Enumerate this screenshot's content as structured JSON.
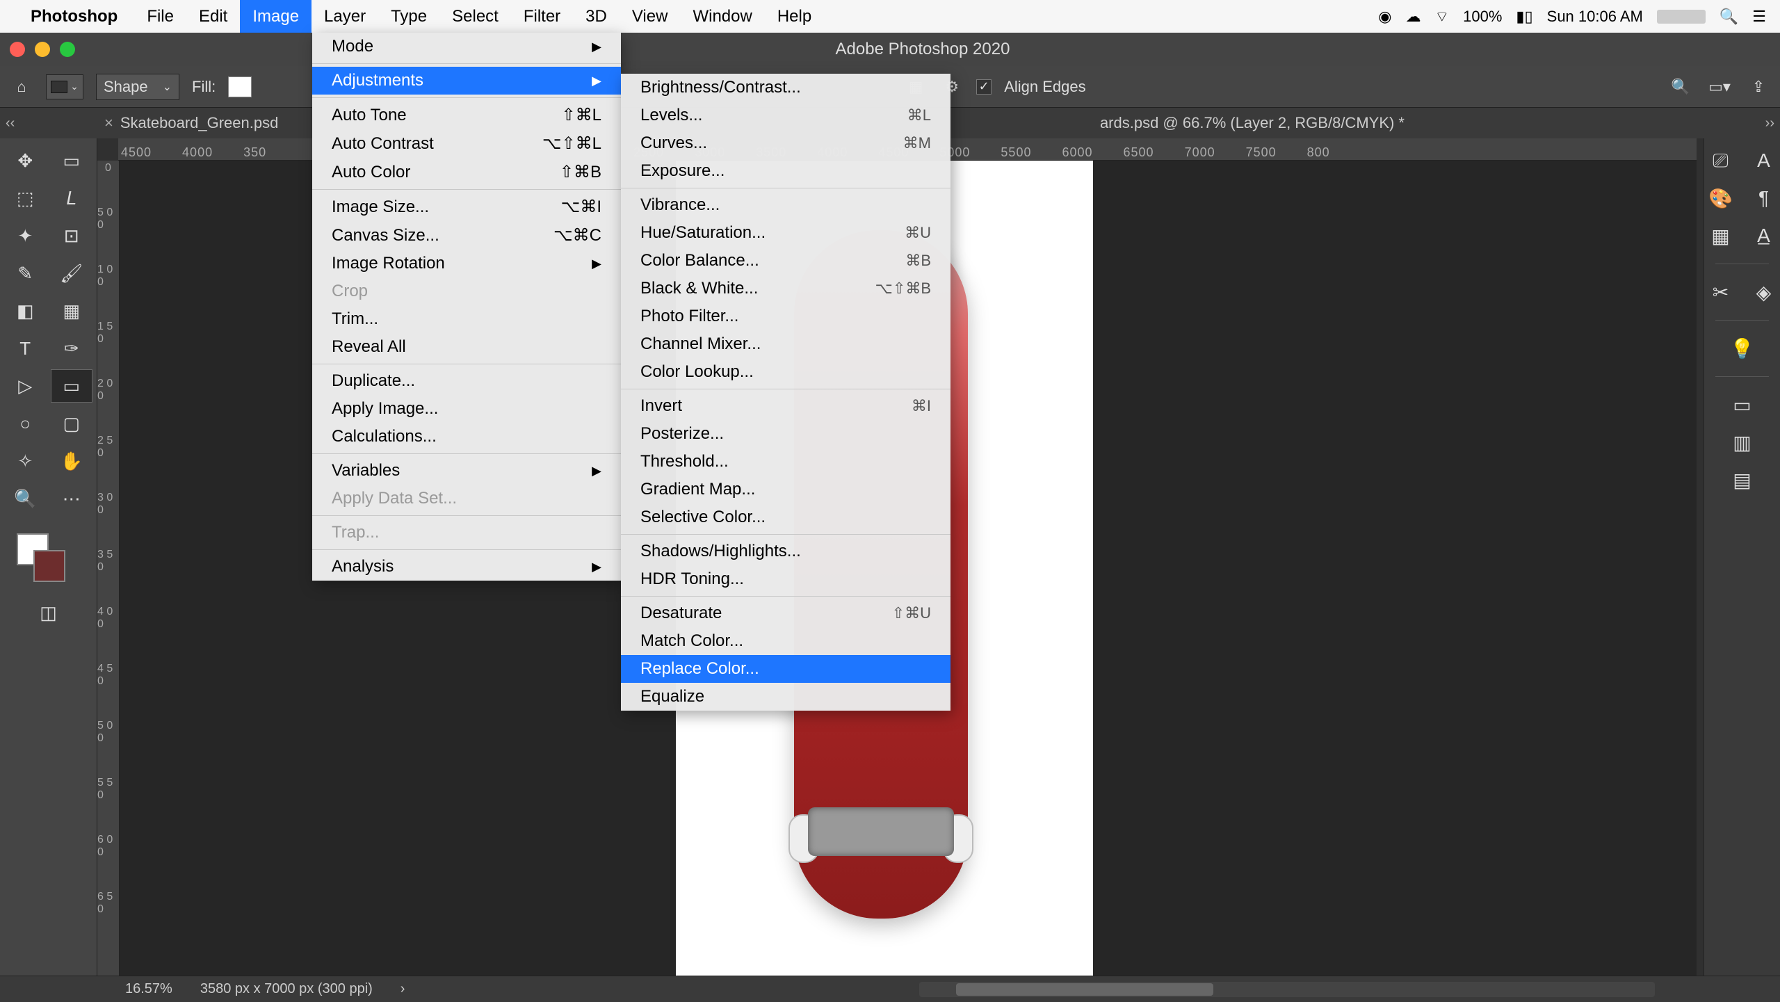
{
  "macMenu": {
    "appName": "Photoshop",
    "items": [
      "File",
      "Edit",
      "Image",
      "Layer",
      "Type",
      "Select",
      "Filter",
      "3D",
      "View",
      "Window",
      "Help"
    ],
    "activeIndex": 2,
    "battery": "100%",
    "clock": "Sun 10:06 AM"
  },
  "windowTitle": "Adobe Photoshop 2020",
  "optionsBar": {
    "shapeMode": "Shape",
    "fillLabel": "Fill:",
    "alignEdges": "Align Edges"
  },
  "tabs": {
    "tab1": "Skateboard_Green.psd",
    "tab2": "ards.psd @ 66.7% (Layer 2, RGB/8/CMYK) *"
  },
  "ruler": {
    "top": [
      "4500",
      "4000",
      "350",
      "",
      "",
      "",
      "",
      "",
      "",
      "",
      "",
      "",
      "",
      "",
      "2500",
      "3000",
      "3500",
      "4000",
      "4500",
      "5000",
      "5500",
      "6000",
      "6500",
      "7000",
      "7500",
      "800"
    ],
    "leftStart": 0,
    "leftLabels": [
      "0",
      "5 0 0",
      "1 0 0",
      "1 5 0",
      "2 0 0",
      "2 5 0",
      "3 0 0",
      "3 5 0",
      "4 0 0",
      "4 5 0",
      "5 0 0",
      "5 5 0",
      "6 0 0",
      "6 5 0"
    ]
  },
  "imageMenu": {
    "items": [
      {
        "label": "Mode",
        "arrow": true
      },
      {
        "divider": true
      },
      {
        "label": "Adjustments",
        "arrow": true,
        "highlight": true
      },
      {
        "divider": true
      },
      {
        "label": "Auto Tone",
        "shortcut": "⇧⌘L"
      },
      {
        "label": "Auto Contrast",
        "shortcut": "⌥⇧⌘L"
      },
      {
        "label": "Auto Color",
        "shortcut": "⇧⌘B"
      },
      {
        "divider": true
      },
      {
        "label": "Image Size...",
        "shortcut": "⌥⌘I"
      },
      {
        "label": "Canvas Size...",
        "shortcut": "⌥⌘C"
      },
      {
        "label": "Image Rotation",
        "arrow": true
      },
      {
        "label": "Crop",
        "disabled": true
      },
      {
        "label": "Trim..."
      },
      {
        "label": "Reveal All"
      },
      {
        "divider": true
      },
      {
        "label": "Duplicate..."
      },
      {
        "label": "Apply Image..."
      },
      {
        "label": "Calculations..."
      },
      {
        "divider": true
      },
      {
        "label": "Variables",
        "arrow": true
      },
      {
        "label": "Apply Data Set...",
        "disabled": true
      },
      {
        "divider": true
      },
      {
        "label": "Trap...",
        "disabled": true
      },
      {
        "divider": true
      },
      {
        "label": "Analysis",
        "arrow": true
      }
    ]
  },
  "adjustmentsSubmenu": {
    "items": [
      {
        "label": "Brightness/Contrast..."
      },
      {
        "label": "Levels...",
        "shortcut": "⌘L"
      },
      {
        "label": "Curves...",
        "shortcut": "⌘M"
      },
      {
        "label": "Exposure..."
      },
      {
        "divider": true
      },
      {
        "label": "Vibrance..."
      },
      {
        "label": "Hue/Saturation...",
        "shortcut": "⌘U"
      },
      {
        "label": "Color Balance...",
        "shortcut": "⌘B"
      },
      {
        "label": "Black & White...",
        "shortcut": "⌥⇧⌘B"
      },
      {
        "label": "Photo Filter..."
      },
      {
        "label": "Channel Mixer..."
      },
      {
        "label": "Color Lookup..."
      },
      {
        "divider": true
      },
      {
        "label": "Invert",
        "shortcut": "⌘I"
      },
      {
        "label": "Posterize..."
      },
      {
        "label": "Threshold..."
      },
      {
        "label": "Gradient Map..."
      },
      {
        "label": "Selective Color..."
      },
      {
        "divider": true
      },
      {
        "label": "Shadows/Highlights..."
      },
      {
        "label": "HDR Toning..."
      },
      {
        "divider": true
      },
      {
        "label": "Desaturate",
        "shortcut": "⇧⌘U"
      },
      {
        "label": "Match Color..."
      },
      {
        "label": "Replace Color...",
        "highlight": true
      },
      {
        "label": "Equalize"
      }
    ]
  },
  "status": {
    "zoom": "16.57%",
    "docInfo": "3580 px x 7000 px (300 ppi)"
  },
  "toolNames": [
    "move",
    "artboard",
    "marquee",
    "lasso",
    "quick-select",
    "crop",
    "eyedropper",
    "brush",
    "eraser",
    "gradient",
    "type",
    "pen",
    "path-select",
    "rectangle",
    "ellipse",
    "rounded-rect",
    "custom-shape",
    "hand",
    "zoom",
    "edit-toolbar"
  ],
  "toolGlyphs": [
    "✥",
    "▭",
    "⬚",
    "𝘓",
    "✦",
    "⊡",
    "✎",
    "🖌",
    "◧",
    "▦",
    "T",
    "✑",
    "▷",
    "▭",
    "○",
    "▢",
    "✧",
    "✋",
    "🔍",
    "⋯"
  ],
  "rightPanelIcons": [
    "properties",
    "character",
    "paragraph",
    "color",
    "swatches",
    "grid",
    "type-panel",
    "adjustments",
    "layers",
    "bulb",
    "pattern",
    "page",
    "masks"
  ]
}
